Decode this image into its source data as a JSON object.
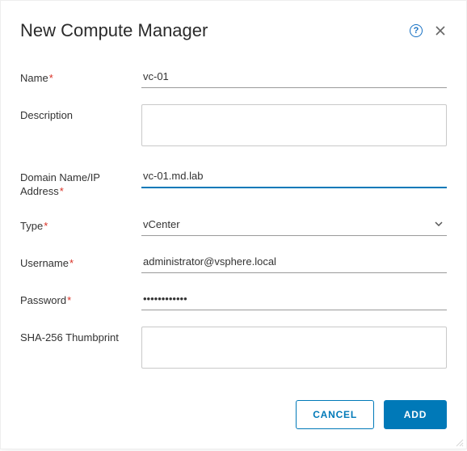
{
  "dialog": {
    "title": "New Compute Manager",
    "help_aria": "Help",
    "close_aria": "Close"
  },
  "form": {
    "name": {
      "label": "Name",
      "value": "vc-01",
      "required": true
    },
    "description": {
      "label": "Description",
      "value": "",
      "required": false
    },
    "domain": {
      "label": "Domain Name/IP Address",
      "value": "vc-01.md.lab",
      "required": true
    },
    "type": {
      "label": "Type",
      "value": "vCenter",
      "required": true
    },
    "username": {
      "label": "Username",
      "value": "administrator@vsphere.local",
      "required": true
    },
    "password": {
      "label": "Password",
      "value": "••••••••••••",
      "required": true
    },
    "thumbprint": {
      "label": "SHA-256 Thumbprint",
      "value": "",
      "required": false
    }
  },
  "footer": {
    "cancel": "CANCEL",
    "add": "ADD"
  },
  "required_marker": "*"
}
